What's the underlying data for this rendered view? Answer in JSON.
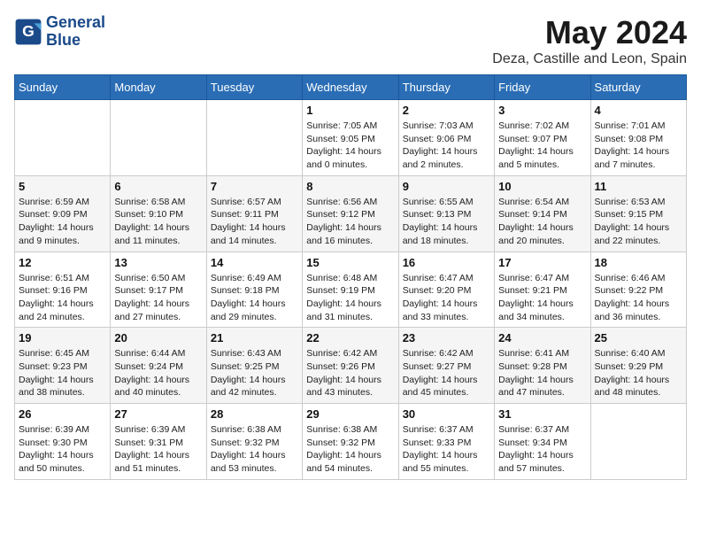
{
  "logo": {
    "line1": "General",
    "line2": "Blue"
  },
  "title": "May 2024",
  "subtitle": "Deza, Castille and Leon, Spain",
  "days_of_week": [
    "Sunday",
    "Monday",
    "Tuesday",
    "Wednesday",
    "Thursday",
    "Friday",
    "Saturday"
  ],
  "weeks": [
    [
      {
        "day": "",
        "info": ""
      },
      {
        "day": "",
        "info": ""
      },
      {
        "day": "",
        "info": ""
      },
      {
        "day": "1",
        "info": "Sunrise: 7:05 AM\nSunset: 9:05 PM\nDaylight: 14 hours and 0 minutes."
      },
      {
        "day": "2",
        "info": "Sunrise: 7:03 AM\nSunset: 9:06 PM\nDaylight: 14 hours and 2 minutes."
      },
      {
        "day": "3",
        "info": "Sunrise: 7:02 AM\nSunset: 9:07 PM\nDaylight: 14 hours and 5 minutes."
      },
      {
        "day": "4",
        "info": "Sunrise: 7:01 AM\nSunset: 9:08 PM\nDaylight: 14 hours and 7 minutes."
      }
    ],
    [
      {
        "day": "5",
        "info": "Sunrise: 6:59 AM\nSunset: 9:09 PM\nDaylight: 14 hours and 9 minutes."
      },
      {
        "day": "6",
        "info": "Sunrise: 6:58 AM\nSunset: 9:10 PM\nDaylight: 14 hours and 11 minutes."
      },
      {
        "day": "7",
        "info": "Sunrise: 6:57 AM\nSunset: 9:11 PM\nDaylight: 14 hours and 14 minutes."
      },
      {
        "day": "8",
        "info": "Sunrise: 6:56 AM\nSunset: 9:12 PM\nDaylight: 14 hours and 16 minutes."
      },
      {
        "day": "9",
        "info": "Sunrise: 6:55 AM\nSunset: 9:13 PM\nDaylight: 14 hours and 18 minutes."
      },
      {
        "day": "10",
        "info": "Sunrise: 6:54 AM\nSunset: 9:14 PM\nDaylight: 14 hours and 20 minutes."
      },
      {
        "day": "11",
        "info": "Sunrise: 6:53 AM\nSunset: 9:15 PM\nDaylight: 14 hours and 22 minutes."
      }
    ],
    [
      {
        "day": "12",
        "info": "Sunrise: 6:51 AM\nSunset: 9:16 PM\nDaylight: 14 hours and 24 minutes."
      },
      {
        "day": "13",
        "info": "Sunrise: 6:50 AM\nSunset: 9:17 PM\nDaylight: 14 hours and 27 minutes."
      },
      {
        "day": "14",
        "info": "Sunrise: 6:49 AM\nSunset: 9:18 PM\nDaylight: 14 hours and 29 minutes."
      },
      {
        "day": "15",
        "info": "Sunrise: 6:48 AM\nSunset: 9:19 PM\nDaylight: 14 hours and 31 minutes."
      },
      {
        "day": "16",
        "info": "Sunrise: 6:47 AM\nSunset: 9:20 PM\nDaylight: 14 hours and 33 minutes."
      },
      {
        "day": "17",
        "info": "Sunrise: 6:47 AM\nSunset: 9:21 PM\nDaylight: 14 hours and 34 minutes."
      },
      {
        "day": "18",
        "info": "Sunrise: 6:46 AM\nSunset: 9:22 PM\nDaylight: 14 hours and 36 minutes."
      }
    ],
    [
      {
        "day": "19",
        "info": "Sunrise: 6:45 AM\nSunset: 9:23 PM\nDaylight: 14 hours and 38 minutes."
      },
      {
        "day": "20",
        "info": "Sunrise: 6:44 AM\nSunset: 9:24 PM\nDaylight: 14 hours and 40 minutes."
      },
      {
        "day": "21",
        "info": "Sunrise: 6:43 AM\nSunset: 9:25 PM\nDaylight: 14 hours and 42 minutes."
      },
      {
        "day": "22",
        "info": "Sunrise: 6:42 AM\nSunset: 9:26 PM\nDaylight: 14 hours and 43 minutes."
      },
      {
        "day": "23",
        "info": "Sunrise: 6:42 AM\nSunset: 9:27 PM\nDaylight: 14 hours and 45 minutes."
      },
      {
        "day": "24",
        "info": "Sunrise: 6:41 AM\nSunset: 9:28 PM\nDaylight: 14 hours and 47 minutes."
      },
      {
        "day": "25",
        "info": "Sunrise: 6:40 AM\nSunset: 9:29 PM\nDaylight: 14 hours and 48 minutes."
      }
    ],
    [
      {
        "day": "26",
        "info": "Sunrise: 6:39 AM\nSunset: 9:30 PM\nDaylight: 14 hours and 50 minutes."
      },
      {
        "day": "27",
        "info": "Sunrise: 6:39 AM\nSunset: 9:31 PM\nDaylight: 14 hours and 51 minutes."
      },
      {
        "day": "28",
        "info": "Sunrise: 6:38 AM\nSunset: 9:32 PM\nDaylight: 14 hours and 53 minutes."
      },
      {
        "day": "29",
        "info": "Sunrise: 6:38 AM\nSunset: 9:32 PM\nDaylight: 14 hours and 54 minutes."
      },
      {
        "day": "30",
        "info": "Sunrise: 6:37 AM\nSunset: 9:33 PM\nDaylight: 14 hours and 55 minutes."
      },
      {
        "day": "31",
        "info": "Sunrise: 6:37 AM\nSunset: 9:34 PM\nDaylight: 14 hours and 57 minutes."
      },
      {
        "day": "",
        "info": ""
      }
    ]
  ]
}
